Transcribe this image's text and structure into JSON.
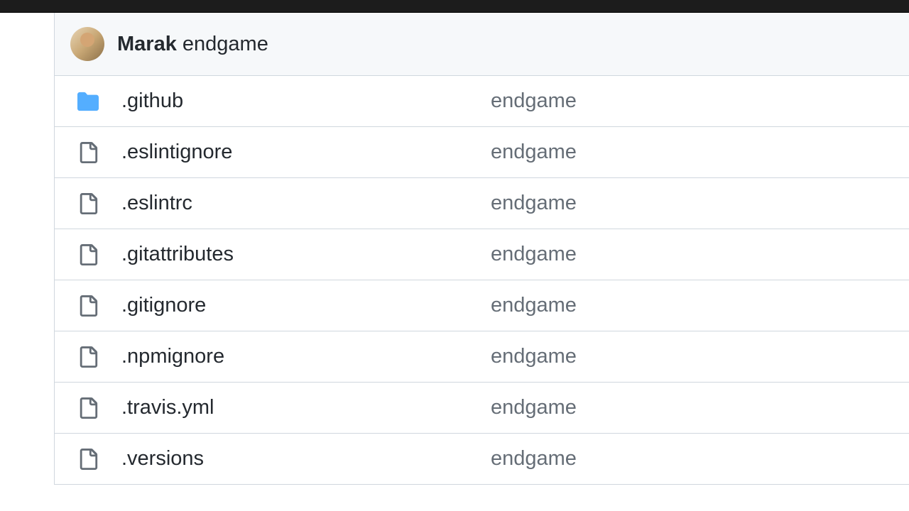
{
  "commit": {
    "author": "Marak",
    "message": "endgame"
  },
  "files": [
    {
      "type": "folder",
      "name": ".github",
      "msg": "endgame"
    },
    {
      "type": "file",
      "name": ".eslintignore",
      "msg": "endgame"
    },
    {
      "type": "file",
      "name": ".eslintrc",
      "msg": "endgame"
    },
    {
      "type": "file",
      "name": ".gitattributes",
      "msg": "endgame"
    },
    {
      "type": "file",
      "name": ".gitignore",
      "msg": "endgame"
    },
    {
      "type": "file",
      "name": ".npmignore",
      "msg": "endgame"
    },
    {
      "type": "file",
      "name": ".travis.yml",
      "msg": "endgame"
    },
    {
      "type": "file",
      "name": ".versions",
      "msg": "endgame"
    }
  ],
  "icons": {
    "folder": "folder-icon",
    "file": "file-icon"
  }
}
